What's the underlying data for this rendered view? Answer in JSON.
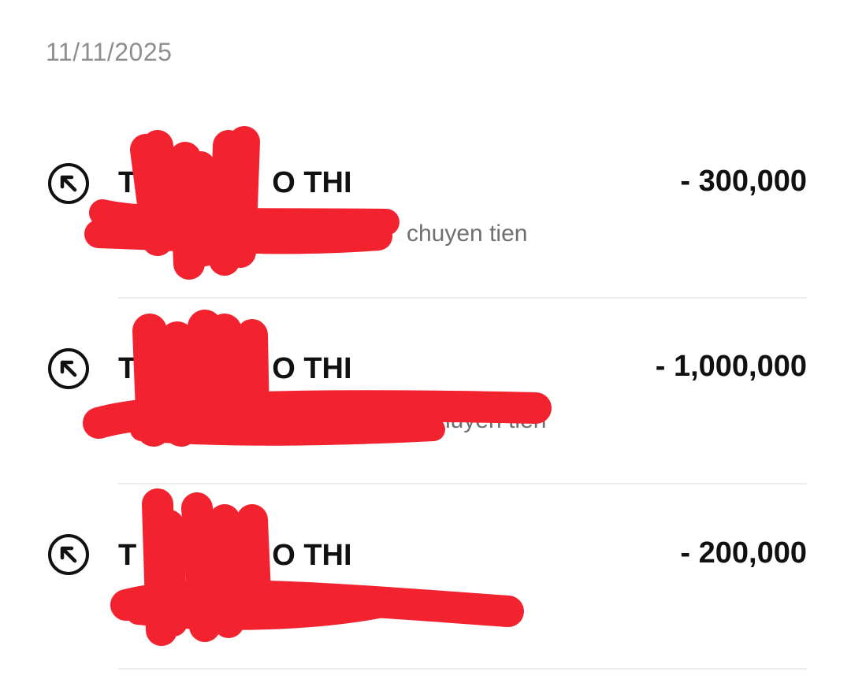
{
  "date_header": "11/11/2025",
  "transactions": [
    {
      "name": "T",
      "name_tail": "O THI",
      "description": "chuyen tien",
      "amount": "- 300,000",
      "icon": "arrow-up-left-circle-icon"
    },
    {
      "name": "T",
      "name_tail": "O THI",
      "description": "chuyen tien",
      "amount": "- 1,000,000",
      "icon": "arrow-up-left-circle-icon"
    },
    {
      "name": "T",
      "name_tail": "O THI",
      "description": "",
      "amount": "- 200,000",
      "icon": "arrow-up-left-circle-icon"
    }
  ],
  "colors": {
    "redaction": "#f2232f",
    "text_primary": "#111111",
    "text_secondary": "#6f6f6f",
    "date": "#8e8e8e",
    "divider": "#ececec"
  }
}
